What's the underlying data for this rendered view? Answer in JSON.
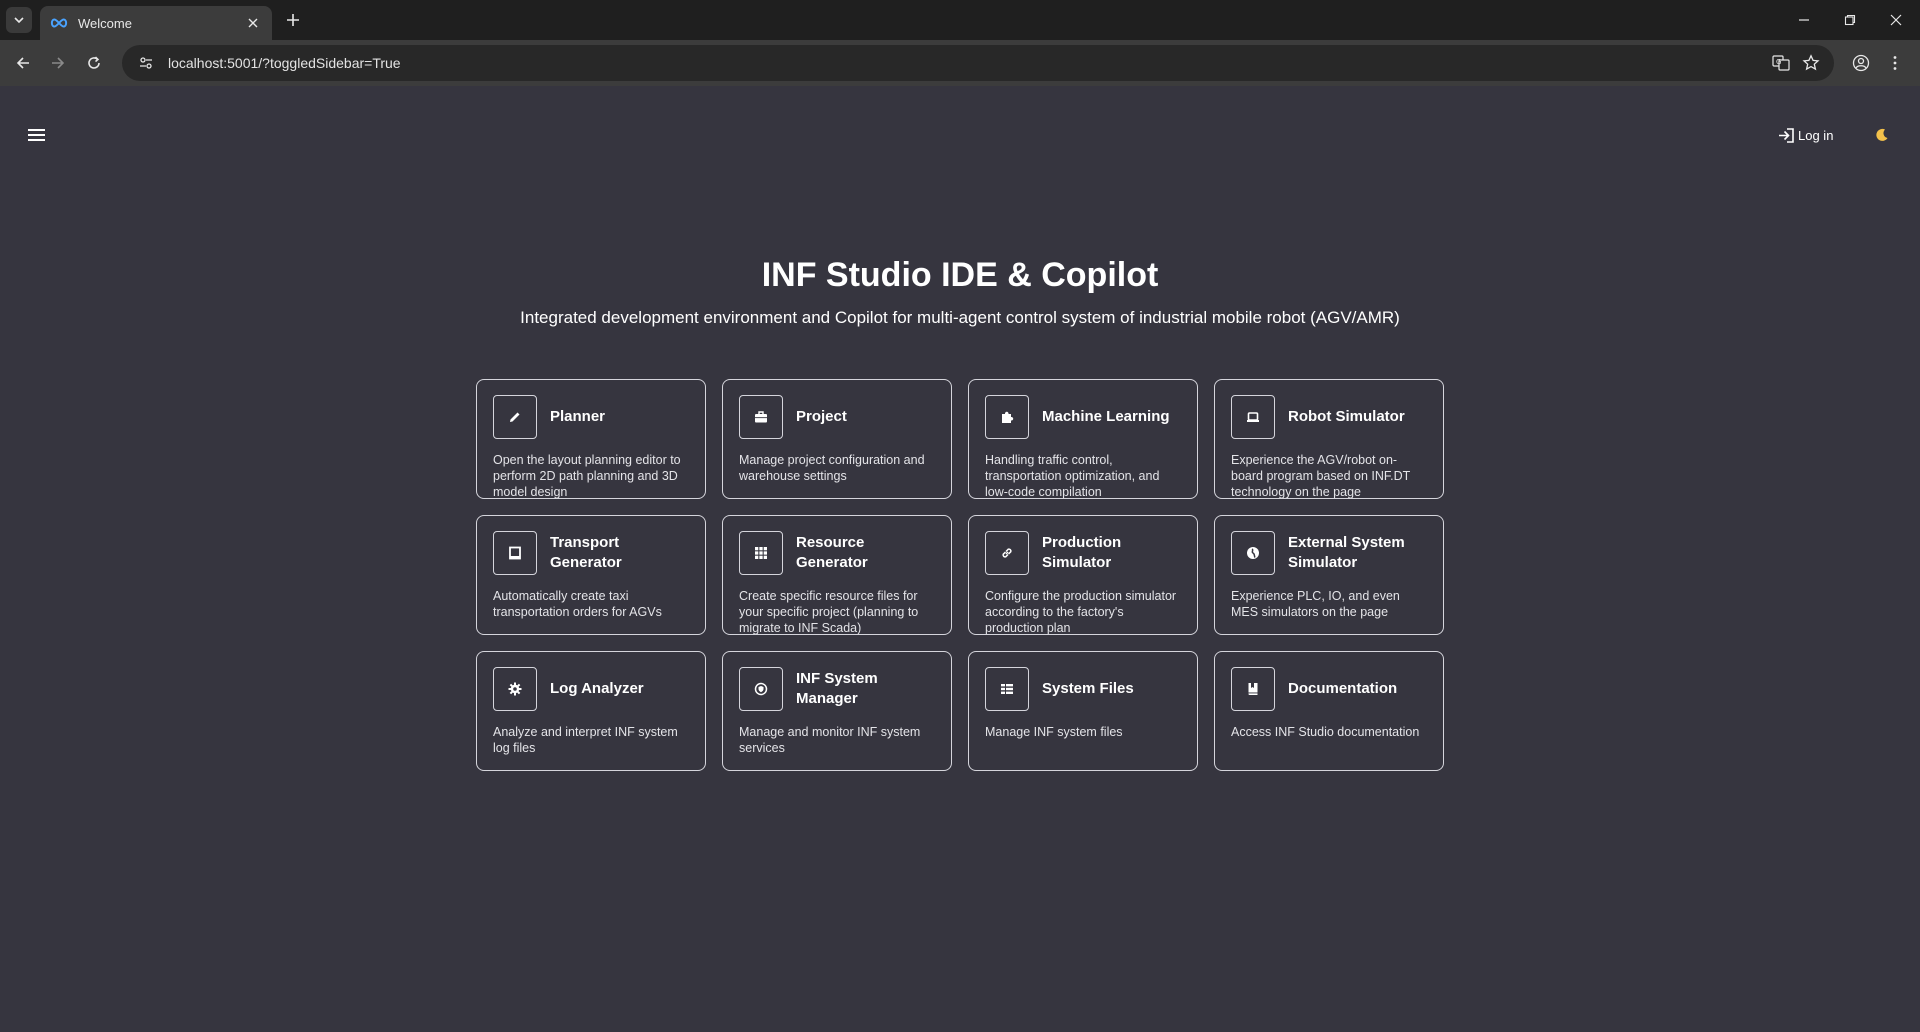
{
  "browser": {
    "tab_title": "Welcome",
    "url": "localhost:5001/?toggledSidebar=True"
  },
  "header": {
    "login_label": "Log in"
  },
  "hero": {
    "title": "INF Studio IDE & Copilot",
    "subtitle": "Integrated development environment and Copilot for multi-agent control system of industrial mobile robot (AGV/AMR)"
  },
  "cards": [
    {
      "title": "Planner",
      "desc": "Open the layout planning editor to perform 2D path planning and 3D model design",
      "icon": "pencil-icon"
    },
    {
      "title": "Project",
      "desc": "Manage project configuration and warehouse settings",
      "icon": "briefcase-icon"
    },
    {
      "title": "Machine Learning",
      "desc": "Handling traffic control, transportation optimization, and low-code compilation",
      "icon": "puzzle-icon"
    },
    {
      "title": "Robot Simulator",
      "desc": "Experience the AGV/robot on-board program based on INF.DT technology on the page",
      "icon": "robot-icon"
    },
    {
      "title": "Transport Generator",
      "desc": "Automatically create taxi transportation orders for AGVs",
      "icon": "square-icon"
    },
    {
      "title": "Resource Generator",
      "desc": "Create specific resource files for your specific project (planning to migrate to INF Scada)",
      "icon": "grid-icon"
    },
    {
      "title": "Production Simulator",
      "desc": "Configure the production simulator according to the factory's production plan",
      "icon": "link-icon"
    },
    {
      "title": "External System Simulator",
      "desc": "Experience PLC, IO, and even MES simulators on the page",
      "icon": "globe-icon"
    },
    {
      "title": "Log Analyzer",
      "desc": "Analyze and interpret INF system log files",
      "icon": "gear-icon"
    },
    {
      "title": "INF System Manager",
      "desc": "Manage and monitor INF system services",
      "icon": "shield-icon"
    },
    {
      "title": "System Files",
      "desc": "Manage INF system files",
      "icon": "list-icon"
    },
    {
      "title": "Documentation",
      "desc": "Access INF Studio documentation",
      "icon": "book-icon"
    }
  ]
}
